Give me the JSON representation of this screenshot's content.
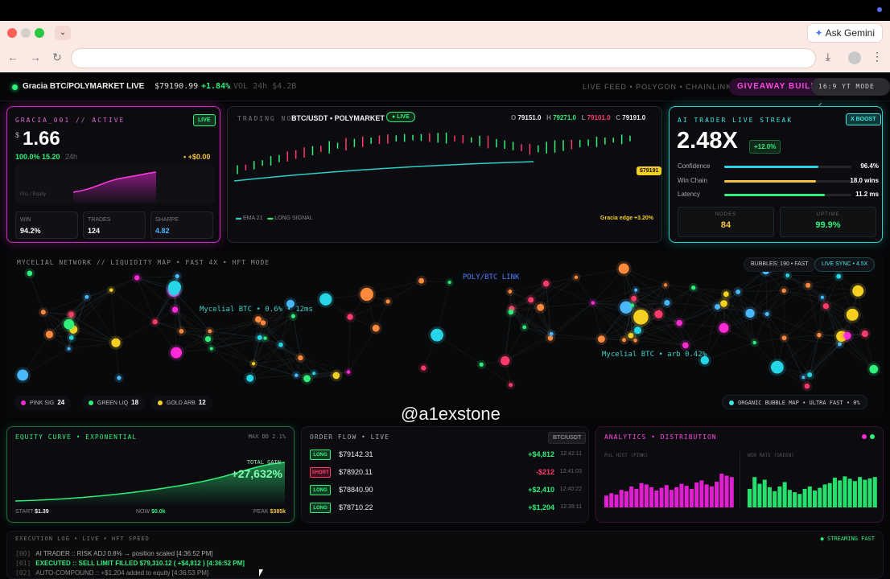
{
  "browser": {
    "gemini_label": "Ask Gemini",
    "tab_dropdown_icon": "chevron-down-icon",
    "address": ""
  },
  "header": {
    "title": "Gracia BTC/POLYMARKET LIVE",
    "price": "$79190.99",
    "change": "+1.84%",
    "volume": "VOL 24h $4.2B",
    "feed": "LIVE FEED • POLYGON • CHAINLINK",
    "giveaway": "GIVEAWAY BUILD v",
    "mode": "16:9 YT MODE ✓"
  },
  "agent_card": {
    "label": "GRACIA_001 // ACTIVE",
    "badge": "LIVE",
    "currency": "$",
    "value": "1.66",
    "pct": "100.0% 15.20",
    "period": "24h",
    "pnl_delta": "+$0.00",
    "chart_label": "PnL / Equity",
    "stats": [
      {
        "k": "WIN",
        "v": "94.2%",
        "color": "#ffffff"
      },
      {
        "k": "TRADES",
        "v": "124",
        "color": "#ffffff"
      },
      {
        "k": "SHARPE",
        "v": "4.82",
        "color": "#4ab8ff"
      }
    ]
  },
  "trading": {
    "label": "TRADING NOW",
    "pair": "BTC/USDT • POLYMARKET",
    "badge": "LIVE",
    "o_label": "O",
    "o": "79151.0",
    "h_label": "H",
    "h": "79271.0",
    "l_label": "L",
    "l": "79101.0",
    "c_label": "C",
    "c": "79191.0",
    "price_tag": "$79191",
    "legend_ema": "EMA 21",
    "legend_long": "LONG SIGNAL",
    "edge": "Gracia edge +3.20%"
  },
  "ai_card": {
    "label": "AI TRADER LIVE STREAK",
    "badge": "X BOOST",
    "multiplier": "2.48X",
    "delta": "+12.0%",
    "bars": [
      {
        "k": "Confidence",
        "v": "96.4%",
        "level": 0.74,
        "color": "#27d6e6"
      },
      {
        "k": "Win Chain",
        "v": "18.0 wins",
        "level": 0.72,
        "color": "#f5c542"
      },
      {
        "k": "Latency",
        "v": "11.2 ms",
        "level": 0.79,
        "color": "#2ef07a"
      }
    ],
    "nodes_label": "NODES",
    "nodes": "84",
    "uptime_label": "UPTIME",
    "uptime": "99.9%"
  },
  "network": {
    "label": "MYCELIAL NETWORK // LIQUIDITY MAP • FAST 4X • HFT MODE",
    "bubbles": "BUBBLES: 190 • FAST",
    "sync": "LIVE SYNC • 4.5X",
    "annot1": "POLY/BTC LINK",
    "annot2": "Mycelial BTC • 0.6% • 12ms",
    "annot3": "Mycelial BTC • arb 0.42%",
    "legend": [
      {
        "k": "PINK SIG",
        "v": "24",
        "color": "#ff2bd6"
      },
      {
        "k": "GREEN LIQ",
        "v": "18",
        "color": "#2ef07a"
      },
      {
        "k": "GOLD ARB",
        "v": "12",
        "color": "#f5d020"
      }
    ],
    "bubble_map": "ORGANIC BUBBLE MAP • ULTRA FAST • 0%"
  },
  "watermark": "@a1exstone",
  "equity": {
    "label": "EQUITY CURVE • EXPONENTIAL",
    "maxdd": "MAX DD 2.1%",
    "total_label": "TOTAL GAIN",
    "total": "+27,632%",
    "start_label": "START",
    "start": "$1.39",
    "now_label": "NOW",
    "now": "$0.0k",
    "peak_label": "PEAK",
    "peak": "$385k"
  },
  "orders": {
    "label": "ORDER FLOW • LIVE",
    "pair": "BTC/USDT",
    "rows": [
      {
        "side": "LONG",
        "price": "$79142.31",
        "pnl": "+$4,812",
        "time": "12:42:11"
      },
      {
        "side": "SHORT",
        "price": "$78920.11",
        "pnl": "-$212",
        "time": "12:41:03"
      },
      {
        "side": "LONG",
        "price": "$78840.90",
        "pnl": "+$2,410",
        "time": "12:40:22"
      },
      {
        "side": "LONG",
        "price": "$78710.22",
        "pnl": "+$1,204",
        "time": "12:39:11"
      }
    ]
  },
  "analytics": {
    "label": "ANALYTICS • DISTRIBUTION",
    "pnl_hist": "PnL HIST (PINK)",
    "win_rate": "WIN RATE (GREEN)",
    "pink_levels": [
      0.35,
      0.42,
      0.38,
      0.52,
      0.48,
      0.62,
      0.55,
      0.72,
      0.68,
      0.6,
      0.5,
      0.58,
      0.66,
      0.52,
      0.6,
      0.7,
      0.64,
      0.55,
      0.74,
      0.8,
      0.68,
      0.62,
      0.76,
      1.0,
      0.94,
      0.9
    ],
    "green_levels": [
      0.55,
      0.9,
      0.7,
      0.82,
      0.6,
      0.48,
      0.62,
      0.75,
      0.52,
      0.45,
      0.4,
      0.55,
      0.62,
      0.5,
      0.58,
      0.68,
      0.72,
      0.88,
      0.8,
      0.92,
      0.85,
      0.78,
      0.9,
      0.82,
      0.86,
      0.9
    ]
  },
  "log": {
    "label": "EXECUTION LOG • LIVE • HFT SPEED",
    "streaming": "STREAMING FAST",
    "lines": [
      {
        "n": "[00]",
        "text": "AI TRADER :: RISK ADJ 0.8% → position scaled [4:36:52 PM]",
        "color": "#aaaaaa"
      },
      {
        "n": "[01]",
        "text": "EXECUTED :: SELL LIMIT FILLED $79,310.12 ( +$4,812 ) [4:36:52 PM]",
        "color": "#2ef07a"
      },
      {
        "n": "[02]",
        "text": "AUTO-COMPOUND :: +$1,204 added to equity [4:36:53 PM]",
        "color": "#888888"
      }
    ]
  }
}
